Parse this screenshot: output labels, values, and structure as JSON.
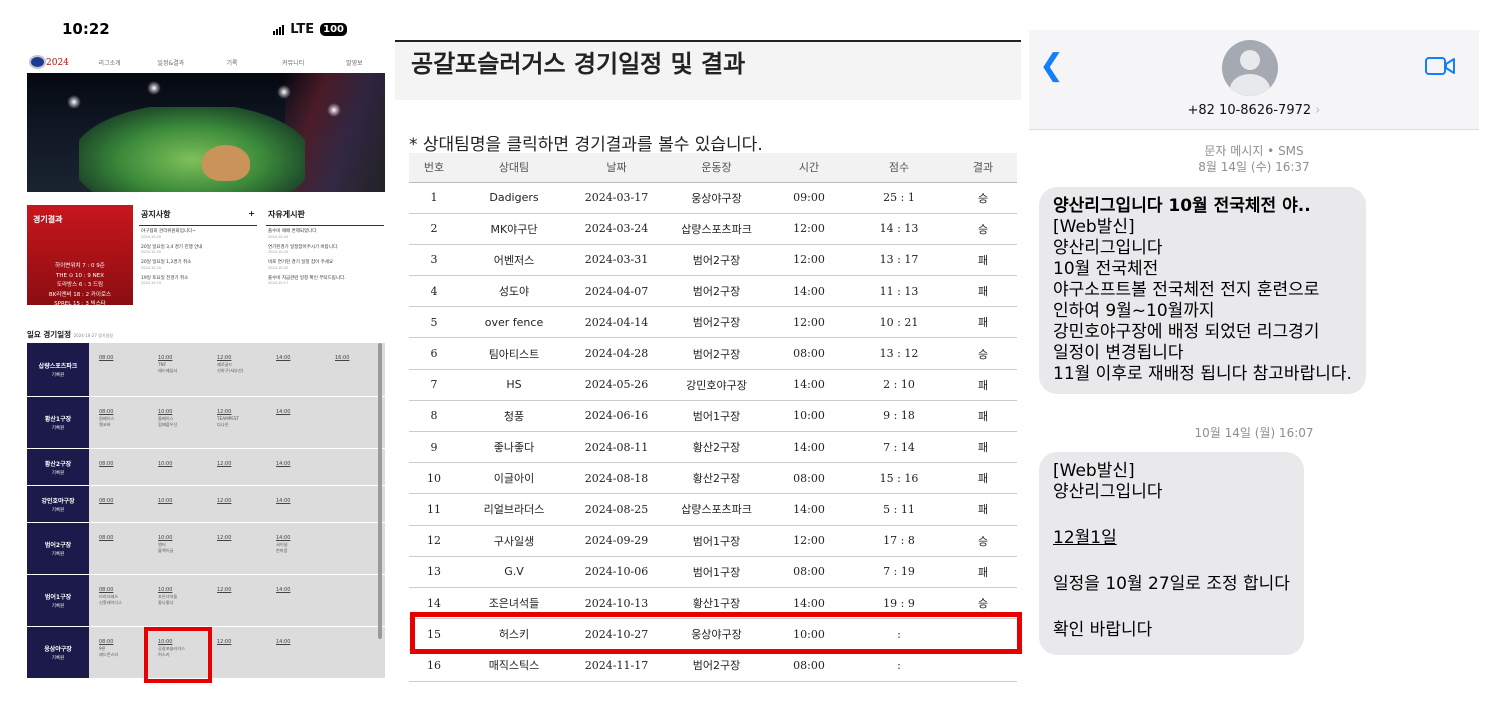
{
  "phone": {
    "status_time": "10:22",
    "status_network": "LTE",
    "status_battery": "100",
    "logo_year": "2024",
    "nav": [
      "리그소개",
      "일정&결과",
      "기록",
      "커뮤니티",
      "발영보"
    ],
    "results_header": "경기결과",
    "results_lines": [
      "하이변위치 7 : 0 9준",
      "THE ⊙ 10 : 9 NEX",
      "도라방스 6 : 3 드림",
      "BK리엔비 18 : 2 카이로스",
      "SPREL 15 : 3 빅스타"
    ],
    "notice_header": "공지사항",
    "notice_items": [
      {
        "t": "야구협회 관리위원회입니다~",
        "d": "2024.10.20"
      },
      {
        "t": "20일 일요일 3,4 경기 진행 안내",
        "d": "2024.10.20"
      },
      {
        "t": "20일 일요일 1,2경기 취소",
        "d": "2024.10.20"
      },
      {
        "t": "19일 토요일 전경기 취소",
        "d": "2024.10.19"
      }
    ],
    "board_header": "자유게시판",
    "board_items": [
      {
        "t": "플수비 패배 면제되었니다",
        "d": "2024.10.20"
      },
      {
        "t": "연기된경기 일정잡아주시기 바랍니다.",
        "d": "2024.10.20"
      },
      {
        "t": "비로 연기된 경기 일정 잡아 주세요",
        "d": "2024.10.20"
      },
      {
        "t": "플수비 지금관련 일정 확인 부탁드립니다.",
        "d": "2024.10.17"
      }
    ],
    "sched_title": "일요 경기일정",
    "sched_sub": "2024-10-27 경기일정",
    "sched_rows": [
      {
        "stadium": "삽량스포츠파크",
        "sub": "기록원",
        "cells": [
          {
            "time": "08:00",
            "a": "",
            "b": ""
          },
          {
            "time": "10:00",
            "a": "TNF",
            "b": "레드제임서"
          },
          {
            "time": "12:00",
            "a": "제로골드",
            "b": "신야구(서부선)"
          },
          {
            "time": "14:00",
            "a": "",
            "b": ""
          },
          {
            "time": "16:00",
            "a": "",
            "b": ""
          }
        ]
      },
      {
        "stadium": "황산1구장",
        "sub": "기록원",
        "cells": [
          {
            "time": "08:00",
            "a": "원베이스",
            "b": "엘코바"
          },
          {
            "time": "10:00",
            "a": "올베이스",
            "b": "힙애플우선"
          },
          {
            "time": "12:00",
            "a": "TEAMPEST",
            "b": "다나인"
          },
          {
            "time": "14:00",
            "a": "",
            "b": ""
          }
        ]
      },
      {
        "stadium": "황산2구장",
        "sub": "기록원",
        "cells": [
          {
            "time": "08:00",
            "a": "",
            "b": ""
          },
          {
            "time": "10:00",
            "a": "",
            "b": ""
          },
          {
            "time": "12:00",
            "a": "",
            "b": ""
          },
          {
            "time": "14:00",
            "a": "",
            "b": ""
          }
        ]
      },
      {
        "stadium": "강민호야구장",
        "sub": "기록원",
        "cells": [
          {
            "time": "08:00",
            "a": "",
            "b": ""
          },
          {
            "time": "10:00",
            "a": "",
            "b": ""
          },
          {
            "time": "12:00",
            "a": "",
            "b": ""
          },
          {
            "time": "14:00",
            "a": "",
            "b": ""
          }
        ]
      },
      {
        "stadium": "범어2구장",
        "sub": "기록원",
        "cells": [
          {
            "time": "08:00",
            "a": "",
            "b": ""
          },
          {
            "time": "10:00",
            "a": "엔터",
            "b": "블랙이글"
          },
          {
            "time": "12:00",
            "a": "",
            "b": ""
          },
          {
            "time": "14:00",
            "a": "서이널",
            "b": "한마음"
          }
        ]
      },
      {
        "stadium": "범어1구장",
        "sub": "기록원",
        "cells": [
          {
            "time": "08:00",
            "a": "브라더레드",
            "b": "신흥레이디스"
          },
          {
            "time": "10:00",
            "a": "조은녀석들",
            "b": "좋나좋다"
          },
          {
            "time": "12:00",
            "a": "",
            "b": ""
          },
          {
            "time": "14:00",
            "a": "",
            "b": ""
          }
        ]
      },
      {
        "stadium": "웅상야구장",
        "sub": "기록원",
        "cells": [
          {
            "time": "08:00",
            "a": "9른",
            "b": "레드몬스터"
          },
          {
            "time": "10:00",
            "a": "공갈포슬러거스",
            "b": "허스키"
          },
          {
            "time": "12:00",
            "a": "",
            "b": ""
          },
          {
            "time": "14:00",
            "a": "",
            "b": ""
          }
        ]
      }
    ]
  },
  "results_page": {
    "title": "공갈포슬러거스 경기일정 및 결과",
    "note": "* 상대팀명을 클릭하면 경기결과를 볼수 있습니다.",
    "columns": [
      "번호",
      "상대팀",
      "날짜",
      "운동장",
      "시간",
      "점수",
      "결과"
    ],
    "rows": [
      [
        "1",
        "Dadigers",
        "2024-03-17",
        "웅상야구장",
        "09:00",
        "25 : 1",
        "승"
      ],
      [
        "2",
        "MK야구단",
        "2024-03-24",
        "삽량스포츠파크",
        "12:00",
        "14 : 13",
        "승"
      ],
      [
        "3",
        "어벤저스",
        "2024-03-31",
        "범어2구장",
        "12:00",
        "13 : 17",
        "패"
      ],
      [
        "4",
        "성도야",
        "2024-04-07",
        "범어2구장",
        "14:00",
        "11 : 13",
        "패"
      ],
      [
        "5",
        "over fence",
        "2024-04-14",
        "범어2구장",
        "12:00",
        "10 : 21",
        "패"
      ],
      [
        "6",
        "팀아티스트",
        "2024-04-28",
        "범어2구장",
        "08:00",
        "13 : 12",
        "승"
      ],
      [
        "7",
        "HS",
        "2024-05-26",
        "강민호야구장",
        "14:00",
        "2 : 10",
        "패"
      ],
      [
        "8",
        "청풍",
        "2024-06-16",
        "범어1구장",
        "10:00",
        "9 : 18",
        "패"
      ],
      [
        "9",
        "좋나좋다",
        "2024-08-11",
        "황산2구장",
        "14:00",
        "7 : 14",
        "패"
      ],
      [
        "10",
        "이글아이",
        "2024-08-18",
        "황산2구장",
        "08:00",
        "15 : 16",
        "패"
      ],
      [
        "11",
        "리얼브라더스",
        "2024-08-25",
        "삽량스포츠파크",
        "14:00",
        "5 : 11",
        "패"
      ],
      [
        "12",
        "구사일생",
        "2024-09-29",
        "범어1구장",
        "12:00",
        "17 : 8",
        "승"
      ],
      [
        "13",
        "G.V",
        "2024-10-06",
        "범어1구장",
        "08:00",
        "7 : 19",
        "패"
      ],
      [
        "14",
        "조은녀석들",
        "2024-10-13",
        "황산1구장",
        "14:00",
        "19 : 9",
        "승"
      ],
      [
        "15",
        "허스키",
        "2024-10-27",
        "웅상야구장",
        "10:00",
        ":",
        ""
      ],
      [
        "16",
        "매직스틱스",
        "2024-11-17",
        "범어2구장",
        "08:00",
        ":",
        ""
      ]
    ]
  },
  "sms": {
    "number": "+82 10-8626-7972",
    "meta1_a": "문자 메시지 • SMS",
    "meta1_b": "8월 14일 (수) 16:37",
    "msg1": [
      "양산리그입니다 10월 전국체전 야..",
      "[Web발신]",
      "양산리그입니다",
      "10월 전국체전",
      "야구소프트볼 전국체전 전지 훈련으로",
      "인하여 9월~10월까지",
      "강민호야구장에 배정 되었던 리그경기",
      "일정이 변경됩니다",
      "11월 이후로 재배정 됩니다 참고바랍니다."
    ],
    "meta2": "10월 14일 (월) 16:07",
    "msg2": [
      "[Web발신]",
      "양산리그입니다",
      "",
      "12월1일",
      "",
      "일정을 10월 27일로 조정 합니다",
      "",
      "확인 바랍니다"
    ]
  },
  "colors": {
    "highlight": "#e60000",
    "ios_blue": "#147efb",
    "stadium_bg": "#1c1a4a",
    "results_red": "#c8161c"
  }
}
